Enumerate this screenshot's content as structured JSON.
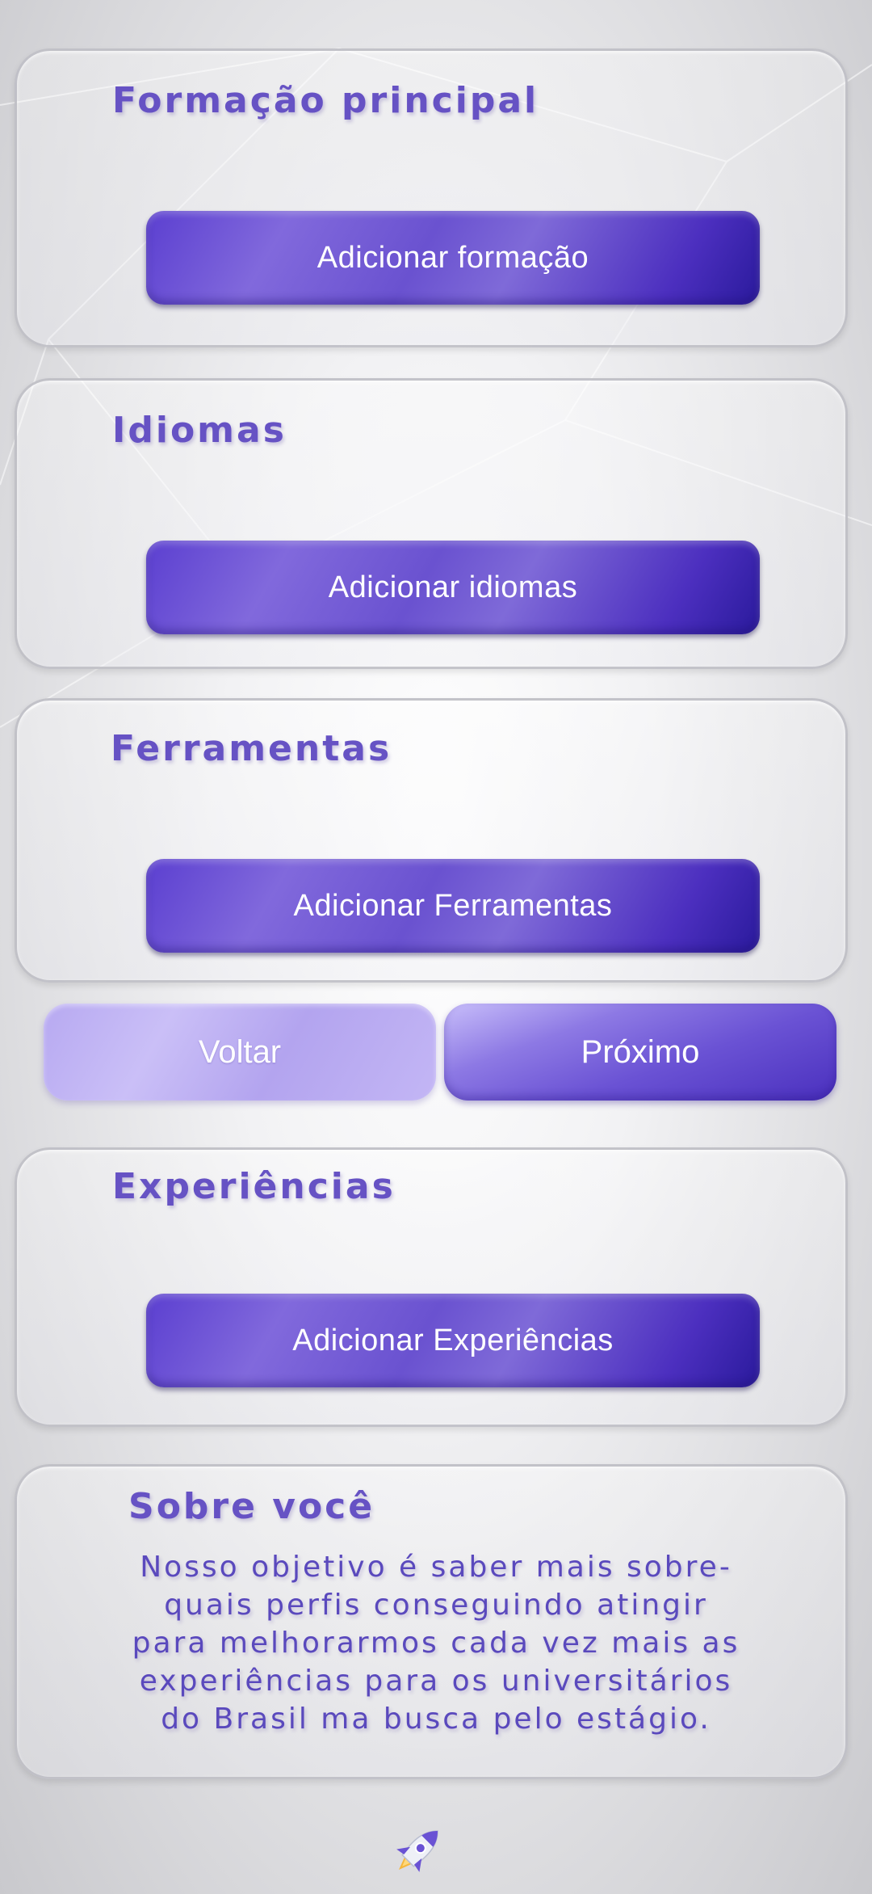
{
  "sections": {
    "formacao": {
      "title": "Formação principal",
      "button": "Adicionar formação"
    },
    "idiomas": {
      "title": "Idiomas",
      "button": "Adicionar idiomas"
    },
    "ferramentas": {
      "title": "Ferramentas",
      "button": "Adicionar Ferramentas"
    },
    "experiencias": {
      "title": "Experiências",
      "button": "Adicionar Experiências"
    }
  },
  "navigation": {
    "back_label": "Voltar",
    "next_label": "Próximo"
  },
  "about": {
    "title": "Sobre você",
    "text": "Nosso objetivo é saber   mais sobre-\nquais perfis conseguindo atingir\npara melhorarmos cada vez mais as\nexperiências para os universitários\ndo Brasil ma busca pelo estágio."
  },
  "icons": {
    "footer": "rocket-icon"
  },
  "colors": {
    "accent": "#6652c4",
    "button_dark": "#4c2fbf",
    "button_light": "#b7a9f1"
  }
}
